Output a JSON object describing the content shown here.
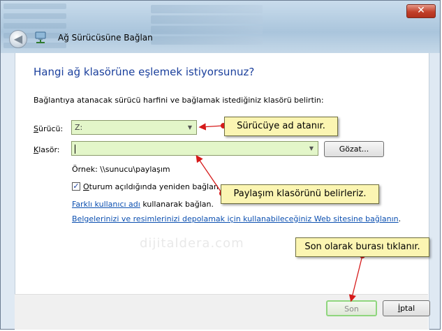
{
  "window": {
    "title": "Ağ Sürücüsüne Bağlan",
    "close_glyph": "✕",
    "back_glyph": "◀"
  },
  "main": {
    "heading": "Hangi ağ klasörüne eşlemek istiyorsunuz?",
    "description": "Bağlantıya atanacak sürücü harfini ve bağlamak istediğiniz klasörü belirtin:",
    "drive": {
      "label_first": "S",
      "label_rest": "ürücü:",
      "value": "Z:"
    },
    "folder": {
      "label_first": "K",
      "label_rest": "lasör:",
      "value": ""
    },
    "browse_label": "Gözat...",
    "example": "Örnek: \\\\sunucu\\paylaşım",
    "reconnect": {
      "checked": true,
      "label_first": "O",
      "label_rest": "turum açıldığında yeniden bağlan"
    },
    "different_user_link": "Farklı kullanıcı adı",
    "different_user_suffix": " kullanarak bağlan.",
    "web_link": "Belgelerinizi ve resimlerinizi depolamak için kullanabileceğiniz Web sitesine bağlanın",
    "web_link_suffix": "."
  },
  "footer": {
    "finish_label": "Son",
    "cancel_first": "İ",
    "cancel_rest": "ptal"
  },
  "annotations": {
    "drive_note": "Sürücüye ad atanır.",
    "folder_note": "Paylaşım klasörünü belirleriz.",
    "finish_note": "Son olarak burası tıklanır."
  },
  "watermark": "dijitaldera.com",
  "colors": {
    "heading": "#1a3f9c",
    "link": "#0b4fb0",
    "field_bg": "#e3f6c9",
    "callout_bg": "#fbf5b2",
    "arrow": "#d61a1a"
  }
}
